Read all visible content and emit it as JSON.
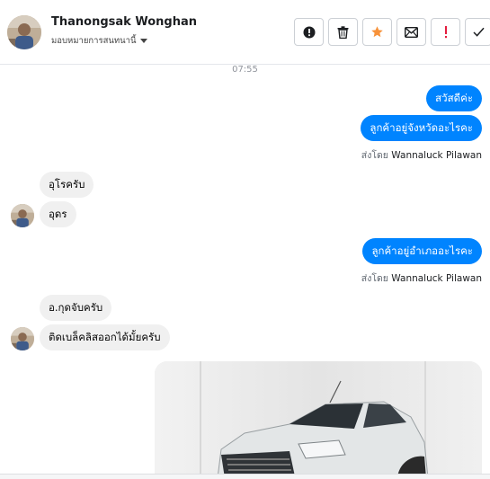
{
  "header": {
    "name": "Thanongsak Wonghan",
    "subtitle": "มอบหมายการสนทนานี้",
    "toolbar": [
      "alert-circle-icon",
      "trash-icon",
      "star-icon",
      "envelope-icon",
      "exclamation-icon",
      "check-icon"
    ]
  },
  "timestamp": "07:55",
  "messages": {
    "m1": "สวัสดีค่ะ",
    "m2": "ลูกค้าอยู่จังหวัดอะไรคะ",
    "sent1_prefix": "ส่งโดย",
    "sent1_name": "Wannaluck Pilawan",
    "m3": "อุโรครับ",
    "m4": "อุดร",
    "m5": "ลูกค้าอยู่อำเภออะไรคะ",
    "sent2_prefix": "ส่งโดย",
    "sent2_name": "Wannaluck Pilawan",
    "m6": "อ.กุดจับครับ",
    "m7": "ติดเบล็คลิสออกได้มั้ยครับ"
  },
  "colors": {
    "outgoing": "#0084ff",
    "incoming": "#f0f0f0",
    "star": "#f7923a",
    "alert": "#e41e3f"
  }
}
